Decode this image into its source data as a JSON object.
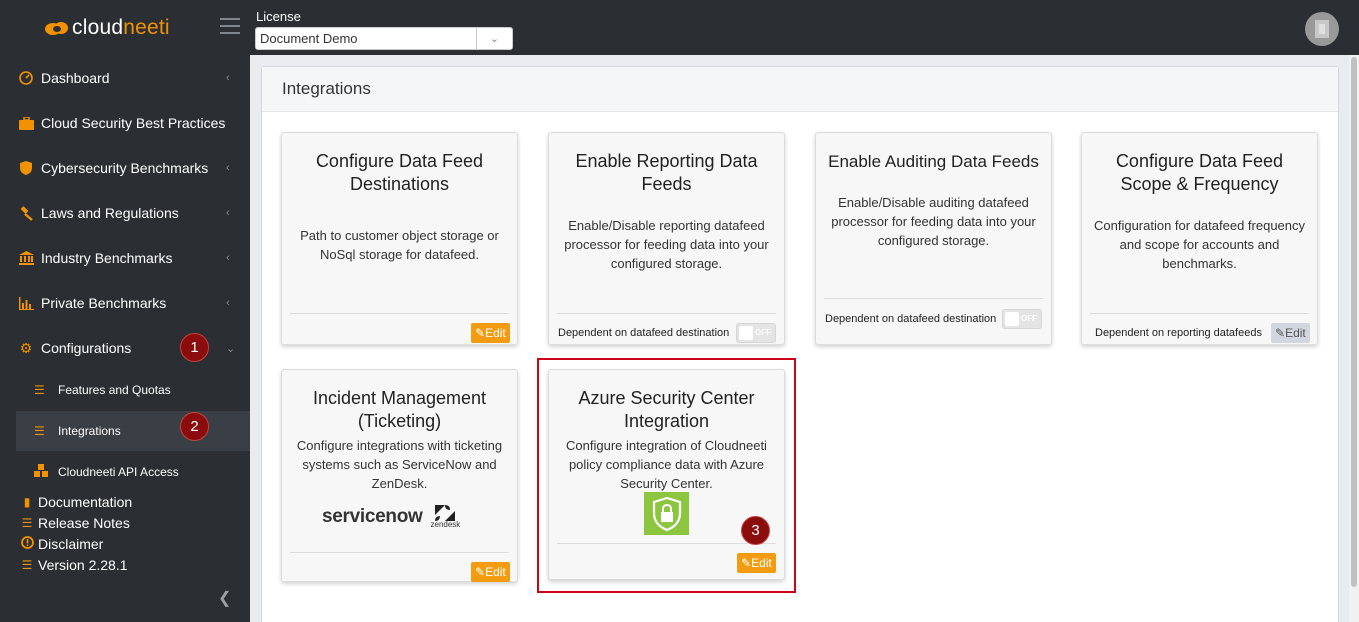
{
  "brand": {
    "part1": "cloud",
    "part2": "neeti"
  },
  "topbar": {
    "license_label": "License",
    "license_value": "Document Demo"
  },
  "sidebar": {
    "items": [
      {
        "label": "Dashboard",
        "icon": "dashboard-icon"
      },
      {
        "label": "Cloud Security Best Practices",
        "icon": "briefcase-icon"
      },
      {
        "label": "Cybersecurity Benchmarks",
        "icon": "shield-icon"
      },
      {
        "label": "Laws and Regulations",
        "icon": "gavel-icon"
      },
      {
        "label": "Industry Benchmarks",
        "icon": "bank-icon"
      },
      {
        "label": "Private Benchmarks",
        "icon": "bar-chart-icon"
      },
      {
        "label": "Configurations",
        "icon": "gear-icon"
      }
    ],
    "subitems": [
      {
        "label": "Features and Quotas",
        "icon": "list-icon"
      },
      {
        "label": "Integrations",
        "icon": "list-icon"
      },
      {
        "label": "Cloudneeti API Access",
        "icon": "cubes-icon"
      }
    ],
    "footer": [
      {
        "label": "Documentation",
        "icon": "book-icon"
      },
      {
        "label": "Release Notes",
        "icon": "list-icon"
      },
      {
        "label": "Disclaimer",
        "icon": "exclamation-icon"
      },
      {
        "label": "Version 2.28.1",
        "icon": "list-alt-icon"
      }
    ]
  },
  "badges": [
    "1",
    "2",
    "3"
  ],
  "main": {
    "title": "Integrations",
    "cards": [
      {
        "title": "Configure Data Feed Destinations",
        "desc": "Path to customer object storage or NoSql storage for datafeed.",
        "edit": "Edit"
      },
      {
        "title": "Enable Reporting Data Feeds",
        "desc": "Enable/Disable reporting datafeed processor for feeding data into your configured storage.",
        "dep": "Dependent on datafeed destination",
        "toggle": "OFF"
      },
      {
        "title": "Enable Auditing Data Feeds",
        "desc": "Enable/Disable auditing datafeed processor for feeding data into your configured storage.",
        "dep": "Dependent on datafeed destination",
        "toggle": "OFF"
      },
      {
        "title": "Configure Data Feed Scope & Frequency",
        "desc": "Configuration for datafeed frequency and scope for accounts and benchmarks.",
        "dep": "Dependent on reporting datafeeds",
        "edit": "Edit"
      },
      {
        "title": "Incident Management (Ticketing)",
        "desc": "Configure integrations with ticketing systems such as ServiceNow and ZenDesk.",
        "edit": "Edit",
        "logo1": "servicenow",
        "logo2": "zendesk"
      },
      {
        "title": "Azure Security Center Integration",
        "desc": "Configure integration of Cloudneeti policy compliance data with Azure Security Center.",
        "edit": "Edit"
      }
    ]
  },
  "colors": {
    "accent": "#f39200",
    "sidebar_bg": "#2b2f33",
    "badge": "#8b0c0c",
    "highlight": "#d0021b",
    "shield": "#8cc63f"
  }
}
